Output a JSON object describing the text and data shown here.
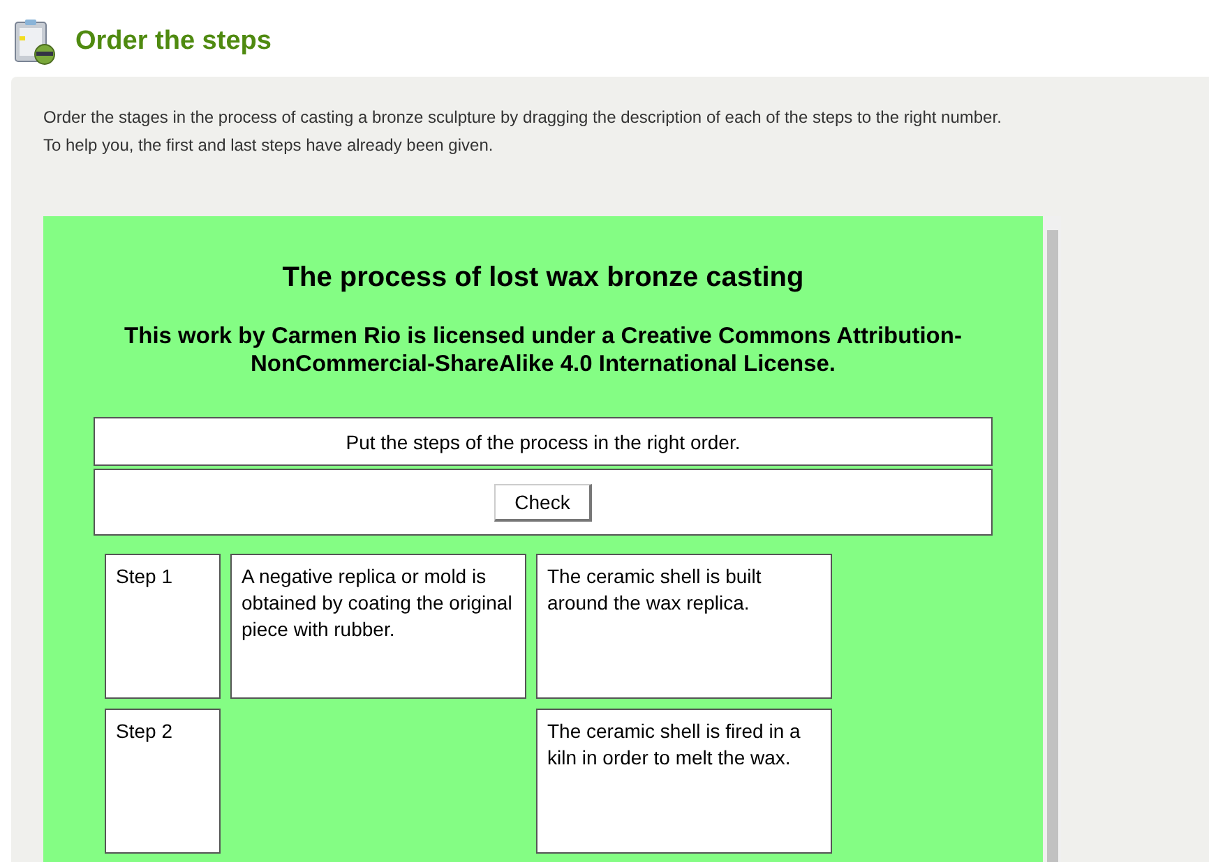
{
  "header": {
    "title": "Order the steps"
  },
  "instructions": [
    "Order the stages in the process of casting a bronze sculpture by dragging the description of each of the steps to the right number.",
    "To help you, the first and last steps have already been given."
  ],
  "activity": {
    "title": "The process of lost wax bronze casting",
    "license": "This work by Carmen Rio is licensed under a Creative Commons Attribution-NonCommercial-ShareAlike 4.0 International License.",
    "prompt": "Put the steps of the process in the right order.",
    "check_button": "Check",
    "rows": [
      {
        "step": "Step 1",
        "slot": "A negative replica or mold is obtained by coating the original piece with rubber.",
        "card": "The ceramic shell is built around the wax replica."
      },
      {
        "step": "Step 2",
        "card": "The ceramic shell is fired in a kiln in order to melt the wax."
      }
    ]
  }
}
